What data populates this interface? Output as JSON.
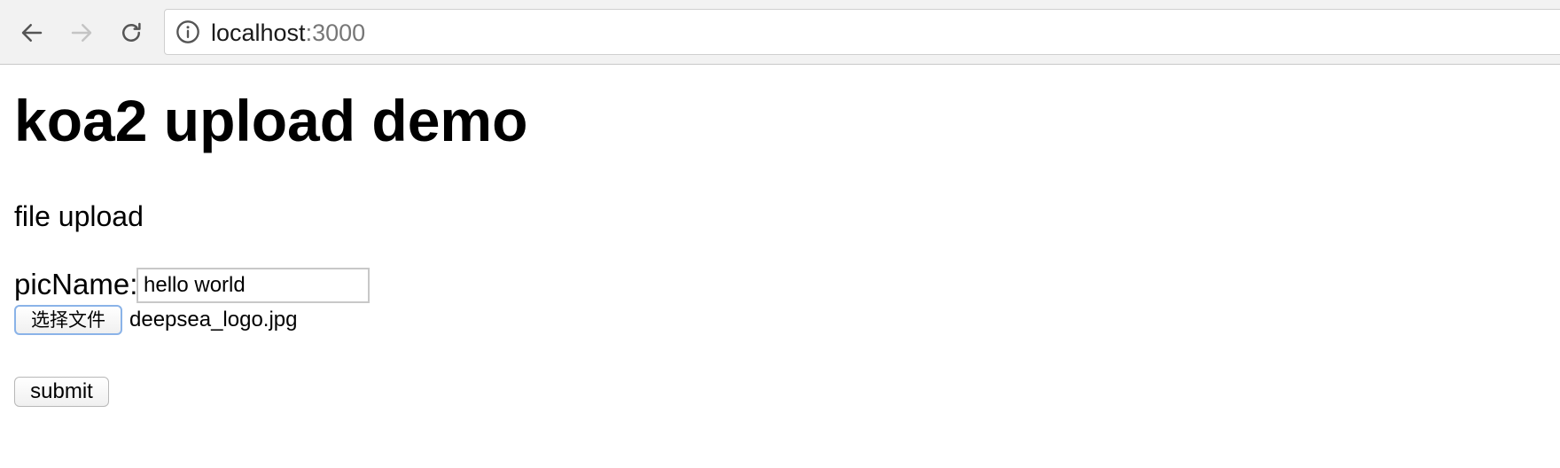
{
  "browser": {
    "url_host": "localhost",
    "url_port": ":3000",
    "icons": {
      "back": "arrow-left-icon",
      "forward": "arrow-right-icon",
      "reload": "reload-icon",
      "site_info": "info-icon"
    }
  },
  "page": {
    "title": "koa2 upload demo",
    "section_title": "file upload",
    "form": {
      "picname_label": "picName:",
      "picname_value": "hello world",
      "file_button_label": "选择文件",
      "file_name": "deepsea_logo.jpg",
      "submit_label": "submit"
    }
  }
}
